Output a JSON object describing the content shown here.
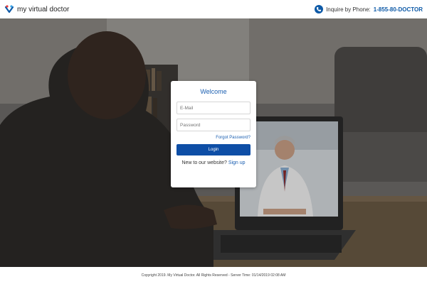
{
  "header": {
    "brand_name": "my virtual doctor",
    "inquire_label": "Inquire by Phone:",
    "phone_number": "1-855-80-DOCTOR"
  },
  "login": {
    "title": "Welcome",
    "email_placeholder": "E-Mail",
    "password_placeholder": "Password",
    "forgot_password": "Forgot Password?",
    "login_button": "Login",
    "new_prompt": "New to our website?",
    "signup_link": "Sign up"
  },
  "footer": {
    "text": "Copyright 2019. My Virtual Doctor. All Rights Reserved - Server Time: 01/14/2019 02:08 AM"
  },
  "icons": {
    "logo": "heart-check-logo-icon",
    "phone": "phone-icon"
  },
  "colors": {
    "brand_blue": "#0e5aa7",
    "link_blue": "#1b5fb1",
    "button_blue": "#0e4ea6"
  }
}
